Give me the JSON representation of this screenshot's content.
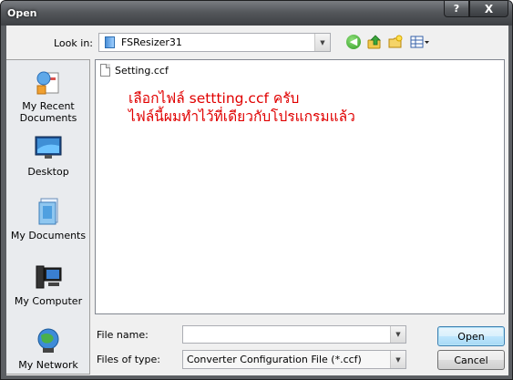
{
  "window": {
    "title": "Open",
    "help_label": "?",
    "close_label": "X"
  },
  "look_in": {
    "label": "Look in:",
    "value": "FSResizer31"
  },
  "toolbar": {
    "back_icon": "back-icon",
    "up_icon": "up-folder-icon",
    "new_folder_icon": "new-folder-icon",
    "views_icon": "views-menu-icon"
  },
  "places": [
    {
      "label": "My Recent Documents",
      "icon": "recent-documents-icon"
    },
    {
      "label": "Desktop",
      "icon": "desktop-icon"
    },
    {
      "label": "My Documents",
      "icon": "my-documents-icon"
    },
    {
      "label": "My Computer",
      "icon": "my-computer-icon"
    },
    {
      "label": "My Network",
      "icon": "my-network-icon"
    }
  ],
  "files": [
    {
      "name": "Setting.ccf",
      "icon": "file-icon"
    }
  ],
  "note": {
    "line1": "เลือกไฟล์ settting.ccf ครับ",
    "line2": "ไฟล์นี้ผมทำไว้ที่เดียวกับโปรแกรมแล้ว",
    "color": "#e00000"
  },
  "file_name": {
    "label": "File name:",
    "value": ""
  },
  "files_of_type": {
    "label": "Files of type:",
    "value": "Converter Configuration File (*.ccf)"
  },
  "buttons": {
    "open": "Open",
    "cancel": "Cancel"
  }
}
